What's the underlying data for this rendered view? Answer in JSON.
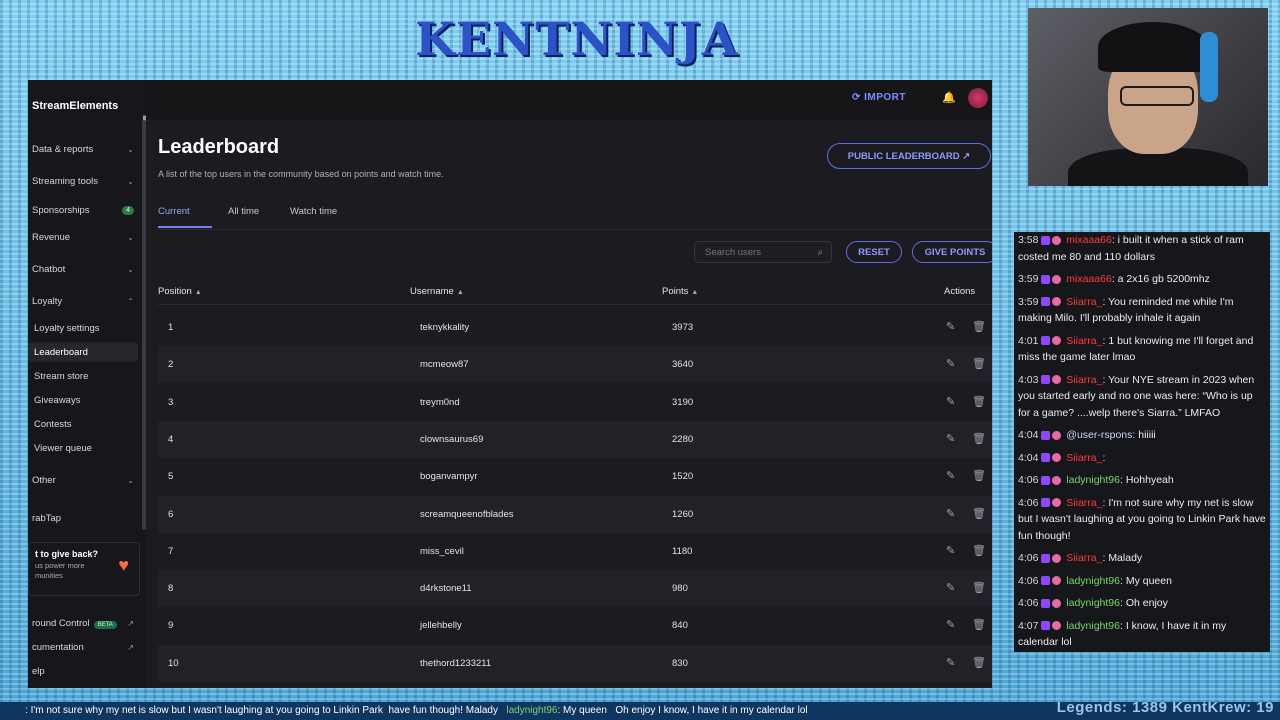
{
  "overlay": {
    "channel_logo": "KENTNINJA",
    "legends_text": "Legends: 1389  KentKrew: 19"
  },
  "sidebar": {
    "brand": "StreamElements",
    "items": [
      {
        "label": "Data & reports",
        "chevron": "chevron-down"
      },
      {
        "label": "Streaming tools",
        "chevron": "chevron-down"
      },
      {
        "label": "Sponsorships",
        "badge": "4"
      },
      {
        "label": "Revenue",
        "chevron": "chevron-down"
      },
      {
        "label": "Chatbot",
        "chevron": "chevron-down"
      },
      {
        "label": "Loyalty",
        "chevron": "chevron-up"
      },
      {
        "label": "Loyalty settings"
      },
      {
        "label": "Leaderboard"
      },
      {
        "label": "Stream store"
      },
      {
        "label": "Giveaways"
      },
      {
        "label": "Contests"
      },
      {
        "label": "Viewer queue"
      },
      {
        "label": "Other",
        "chevron": "chevron-down"
      },
      {
        "label": "rabTap"
      },
      {
        "label": "round Control",
        "badge": "BETA"
      },
      {
        "label": "cumentation"
      },
      {
        "label": "elp"
      }
    ],
    "giveback": {
      "title": "t to give back?",
      "subtitle": "us power more\nmunities"
    }
  },
  "header": {
    "import_label": "IMPORT"
  },
  "page": {
    "title": "Leaderboard",
    "subtitle": "A list of the top users in the community based on points and watch time.",
    "public_button": "PUBLIC LEADERBOARD",
    "tabs": [
      "Current",
      "All time",
      "Watch time"
    ],
    "search_placeholder": "Search users",
    "reset_label": "RESET",
    "give_points_label": "GIVE POINTS"
  },
  "table": {
    "columns": [
      "Position",
      "Username",
      "Points",
      "Actions"
    ],
    "rows": [
      {
        "position": "1",
        "username": "teknykkality",
        "points": "3973"
      },
      {
        "position": "2",
        "username": "mcmeow87",
        "points": "3640"
      },
      {
        "position": "3",
        "username": "treym0nd",
        "points": "3190"
      },
      {
        "position": "4",
        "username": "clownsaurus69",
        "points": "2280"
      },
      {
        "position": "5",
        "username": "boganvampyr",
        "points": "1520"
      },
      {
        "position": "6",
        "username": "screamqueenofblades",
        "points": "1260"
      },
      {
        "position": "7",
        "username": "miss_cevil",
        "points": "1180"
      },
      {
        "position": "8",
        "username": "d4rkstone11",
        "points": "980"
      },
      {
        "position": "9",
        "username": "jellehbelly",
        "points": "840"
      },
      {
        "position": "10",
        "username": "thethord1233211",
        "points": "830"
      }
    ]
  },
  "chat": [
    {
      "time": "3:58",
      "user": "mixaaa66",
      "color": "red",
      "text": "i built it when a stick of ram costed me 80 and 110 dollars"
    },
    {
      "time": "3:59",
      "user": "mixaaa66",
      "color": "red",
      "text": "a 2x16 gb 5200mhz"
    },
    {
      "time": "3:59",
      "user": "Siiarra_",
      "color": "red",
      "text": "You reminded me while I'm making Milo. I'll probably inhale it again"
    },
    {
      "time": "4:01",
      "user": "Siiarra_",
      "color": "red",
      "text": "1 but knowing me I'll forget and miss the game later lmao"
    },
    {
      "time": "4:03",
      "user": "Siiarra_",
      "color": "red",
      "text": "Your NYE stream in 2023 when you started early and no one was here: “Who is up for a game? ....welp there's Siarra.” LMFAO"
    },
    {
      "time": "4:04",
      "user": "@user-rspons",
      "color": "blue",
      "text": "hiiiii"
    },
    {
      "time": "4:04",
      "user": "Siiarra_",
      "color": "red",
      "text": ""
    },
    {
      "time": "4:06",
      "user": "ladynight96",
      "color": "green",
      "text": "Hohhyeah"
    },
    {
      "time": "4:06",
      "user": "Siiarra_",
      "color": "red",
      "text": "I'm not sure why my net is slow but I wasn't laughing at you going to Linkin Park have fun though!"
    },
    {
      "time": "4:06",
      "user": "Siiarra_",
      "color": "red",
      "text": "Malady"
    },
    {
      "time": "4:06",
      "user": "ladynight96",
      "color": "green",
      "text": "My queen"
    },
    {
      "time": "4:06",
      "user": "ladynight96",
      "color": "green",
      "text": "Oh enjoy"
    },
    {
      "time": "4:07",
      "user": "ladynight96",
      "color": "green",
      "text": "I know, I have it in my calendar lol"
    }
  ],
  "ticker": {
    "text1": ": I'm not sure why my net is slow but I wasn't laughing at you going to Linkin Park",
    "text2": "have fun though! Malady",
    "text3": "ladynight96",
    "text4": ": My queen",
    "text5": "Oh enjoy  I know, I have it in my calendar lol"
  }
}
